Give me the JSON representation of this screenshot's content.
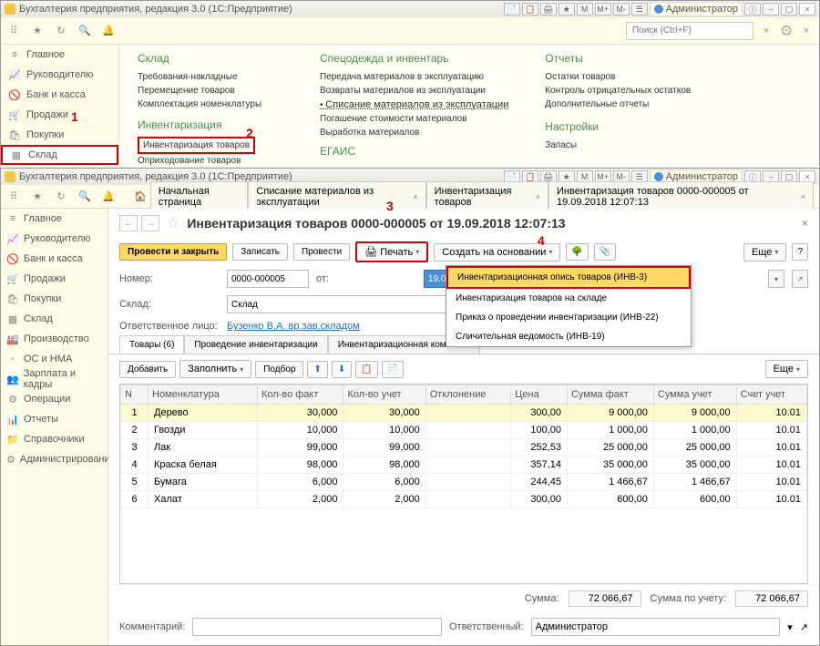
{
  "win1": {
    "title": "Бухгалтерия предприятия, редакция 3.0 (1С:Предприятие)",
    "admin": "Администратор",
    "search_placeholder": "Поиск (Ctrl+F)",
    "sidebar": [
      {
        "icon": "≡",
        "label": "Главное"
      },
      {
        "icon": "📈",
        "label": "Руководителю"
      },
      {
        "icon": "🚫",
        "label": "Банк и касса"
      },
      {
        "icon": "🛒",
        "label": "Продажи"
      },
      {
        "icon": "🛍",
        "label": "Покупки"
      },
      {
        "icon": "▦",
        "label": "Склад"
      }
    ],
    "panel": {
      "sklad": {
        "title": "Склад",
        "links": [
          "Требования-накладные",
          "Перемещение товаров",
          "Комплектация номенклатуры"
        ]
      },
      "invent": {
        "title": "Инвентаризация",
        "links": [
          "Инвентаризация товаров",
          "Оприходование товаров"
        ]
      },
      "spec": {
        "title": "Спецодежда и инвентарь",
        "links": [
          "Передача материалов в эксплуатацию",
          "Возвраты материалов из эксплуатации",
          "Списание материалов из эксплуатации",
          "Погашение стоимости материалов",
          "Выработка материалов"
        ]
      },
      "egais": "ЕГАИС",
      "reports": {
        "title": "Отчеты",
        "links": [
          "Остатки товаров",
          "Контроль отрицательных остатков",
          "Дополнительные отчеты"
        ]
      },
      "settings": {
        "title": "Настройки",
        "links": [
          "Запасы"
        ]
      }
    }
  },
  "annotations": {
    "a1": "1",
    "a2": "2",
    "a3": "3",
    "a4": "4"
  },
  "win2": {
    "title": "Бухгалтерия предприятия, редакция 3.0 (1С:Предприятие)",
    "admin": "Администратор",
    "tabs": [
      "Начальная страница",
      "Списание материалов из эксплуатации",
      "Инвентаризация товаров",
      "Инвентаризация товаров 0000-000005 от 19.09.2018 12:07:13"
    ],
    "sidebar": [
      {
        "icon": "≡",
        "label": "Главное"
      },
      {
        "icon": "📈",
        "label": "Руководителю"
      },
      {
        "icon": "🚫",
        "label": "Банк и касса"
      },
      {
        "icon": "🛒",
        "label": "Продажи"
      },
      {
        "icon": "🛍",
        "label": "Покупки"
      },
      {
        "icon": "▦",
        "label": "Склад"
      },
      {
        "icon": "🏭",
        "label": "Производство"
      },
      {
        "icon": "▫",
        "label": "ОС и НМА"
      },
      {
        "icon": "👥",
        "label": "Зарплата и кадры"
      },
      {
        "icon": "⚙",
        "label": "Операции"
      },
      {
        "icon": "📊",
        "label": "Отчеты"
      },
      {
        "icon": "📁",
        "label": "Справочники"
      },
      {
        "icon": "⚙",
        "label": "Администрирование"
      }
    ],
    "doc_title": "Инвентаризация товаров 0000-000005 от 19.09.2018 12:07:13",
    "actions": {
      "save_close": "Провести и закрыть",
      "save": "Записать",
      "post": "Провести",
      "print": "Печать",
      "create_based": "Создать на основании",
      "more": "Еще"
    },
    "dropdown": [
      "Инвентаризационная опись товаров (ИНВ-3)",
      "Инвентаризация товаров на складе",
      "Приказ о проведении инвентаризации (ИНВ-22)",
      "Сличительная ведомость (ИНВ-19)"
    ],
    "form": {
      "number_label": "Номер:",
      "number": "0000-000005",
      "date_label": "от:",
      "date": "19.09.2018 12:0",
      "sklad_label": "Склад:",
      "sklad": "Склад",
      "resp_label": "Ответственное лицо:",
      "resp": "Бузенко В.А.  вр.зав.складом"
    },
    "tabs3": [
      "Товары (6)",
      "Проведение инвентаризации",
      "Инвентаризационная комиссия"
    ],
    "tablebar": {
      "add": "Добавить",
      "fill": "Заполнить",
      "select": "Подбор",
      "more": "Еще"
    },
    "table": {
      "headers": [
        "N",
        "Номенклатура",
        "Кол-во факт",
        "Кол-во учет",
        "Отклонение",
        "Цена",
        "Сумма факт",
        "Сумма учет",
        "Счет учет"
      ],
      "rows": [
        {
          "n": "1",
          "name": "Дерево",
          "fact": "30,000",
          "uchet": "30,000",
          "dev": "",
          "price": "300,00",
          "sfact": "9 000,00",
          "suchet": "9 000,00",
          "acc": "10.01"
        },
        {
          "n": "2",
          "name": "Гвозди",
          "fact": "10,000",
          "uchet": "10,000",
          "dev": "",
          "price": "100,00",
          "sfact": "1 000,00",
          "suchet": "1 000,00",
          "acc": "10.01"
        },
        {
          "n": "3",
          "name": "Лак",
          "fact": "99,000",
          "uchet": "99,000",
          "dev": "",
          "price": "252,53",
          "sfact": "25 000,00",
          "suchet": "25 000,00",
          "acc": "10.01"
        },
        {
          "n": "4",
          "name": "Краска белая",
          "fact": "98,000",
          "uchet": "98,000",
          "dev": "",
          "price": "357,14",
          "sfact": "35 000,00",
          "suchet": "35 000,00",
          "acc": "10.01"
        },
        {
          "n": "5",
          "name": "Бумага",
          "fact": "6,000",
          "uchet": "6,000",
          "dev": "",
          "price": "244,45",
          "sfact": "1 466,67",
          "suchet": "1 466,67",
          "acc": "10.01"
        },
        {
          "n": "6",
          "name": "Халат",
          "fact": "2,000",
          "uchet": "2,000",
          "dev": "",
          "price": "300,00",
          "sfact": "600,00",
          "suchet": "600,00",
          "acc": "10.01"
        }
      ]
    },
    "footer": {
      "sum_label": "Сумма:",
      "sum": "72 066,67",
      "sum2_label": "Сумма по учету:",
      "sum2": "72 066,67"
    },
    "comment": {
      "label": "Комментарий:",
      "resp_label": "Ответственный:",
      "resp": "Администратор"
    }
  }
}
